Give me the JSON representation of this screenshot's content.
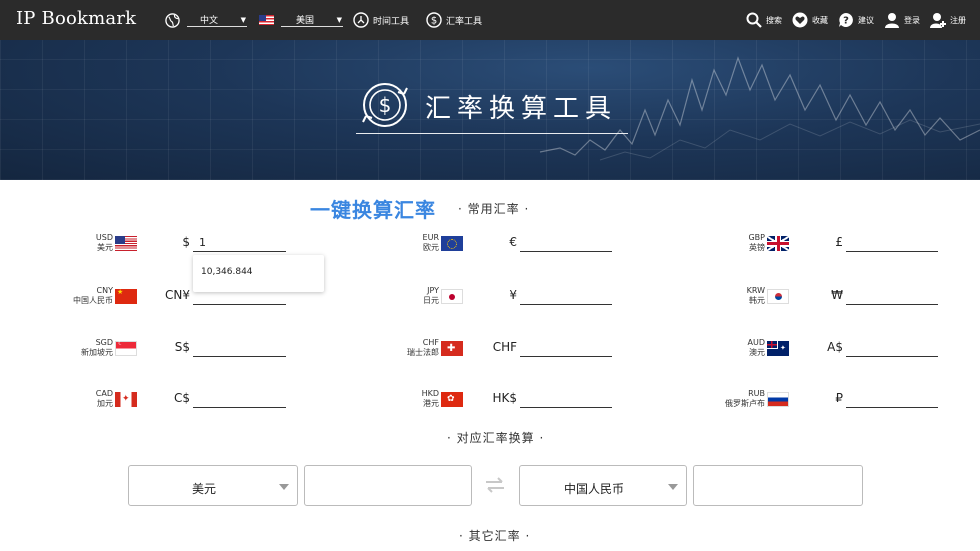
{
  "nav": {
    "brand": "IP Bookmark",
    "language": "中文",
    "country": "美国",
    "time_tool": "时间工具",
    "rate_tool": "汇率工具",
    "search": "搜索",
    "favorite": "收藏",
    "suggest": "建议",
    "login": "登录",
    "register": "注册"
  },
  "hero": {
    "title": "汇率换算工具"
  },
  "sections": {
    "one_click": "一键换算汇率",
    "common": "· 常用汇率 ·",
    "pair": "· 对应汇率换算 ·",
    "other": "· 其它汇率 ·"
  },
  "currencies": [
    {
      "code": "USD",
      "name": "美元",
      "symbol": "$",
      "value": "1"
    },
    {
      "code": "EUR",
      "name": "欧元",
      "symbol": "€",
      "value": ""
    },
    {
      "code": "GBP",
      "name": "英镑",
      "symbol": "£",
      "value": ""
    },
    {
      "code": "CNY",
      "name": "中国人民币",
      "symbol": "CN¥",
      "value": ""
    },
    {
      "code": "JPY",
      "name": "日元",
      "symbol": "¥",
      "value": ""
    },
    {
      "code": "KRW",
      "name": "韩元",
      "symbol": "₩",
      "value": ""
    },
    {
      "code": "SGD",
      "name": "新加坡元",
      "symbol": "S$",
      "value": ""
    },
    {
      "code": "CHF",
      "name": "瑞士法郎",
      "symbol": "CHF",
      "value": ""
    },
    {
      "code": "AUD",
      "name": "澳元",
      "symbol": "A$",
      "value": ""
    },
    {
      "code": "CAD",
      "name": "加元",
      "symbol": "C$",
      "value": ""
    },
    {
      "code": "HKD",
      "name": "港元",
      "symbol": "HK$",
      "value": ""
    },
    {
      "code": "RUB",
      "name": "俄罗斯卢布",
      "symbol": "₽",
      "value": ""
    }
  ],
  "autocomplete": {
    "suggestion": "10,346.844"
  },
  "converter": {
    "from": "美元",
    "to": "中国人民币",
    "from_amount": "",
    "to_amount": ""
  },
  "colors": {
    "nav_bg": "#2b2b2b",
    "heading_blue": "#3a86e0",
    "hero_bg": "#1d3658"
  }
}
